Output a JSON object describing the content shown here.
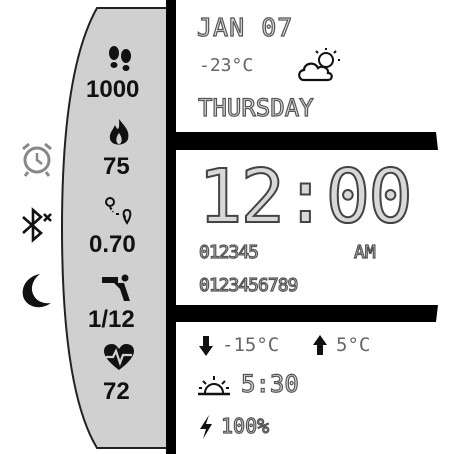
{
  "date": {
    "month_day": "JAN 07",
    "weekday": "THURSDAY"
  },
  "weather": {
    "current_temp": "-23°C",
    "icon": "partly-cloudy-icon",
    "low_temp": "-15°C",
    "high_temp": "5°C",
    "sunrise_time": "5:30"
  },
  "time": {
    "main": "12:00",
    "seconds_row": "012345",
    "ampm": "AM",
    "digits_row": "0123456789"
  },
  "stats": {
    "steps": {
      "icon": "footsteps-icon",
      "value": "1000"
    },
    "calories": {
      "icon": "flame-icon",
      "value": "75"
    },
    "distance": {
      "icon": "route-icon",
      "value": "0.70"
    },
    "floors": {
      "icon": "stairs-climb-icon",
      "value": "1/12"
    },
    "heart_rate": {
      "icon": "heart-pulse-icon",
      "value": "72"
    }
  },
  "status": {
    "alarm_icon": "alarm-clock-icon",
    "bluetooth_icon": "bluetooth-off-icon",
    "dnd_icon": "moon-icon"
  },
  "battery": {
    "icon": "lightning-icon",
    "value": "100%"
  }
}
